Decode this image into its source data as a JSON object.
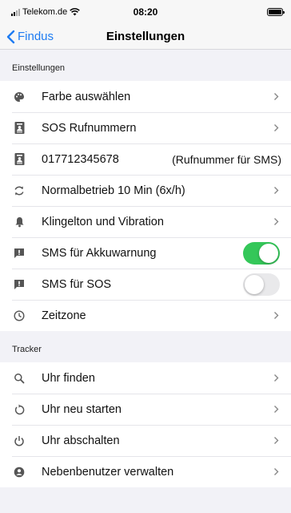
{
  "status": {
    "carrier": "Telekom.de",
    "time": "08:20"
  },
  "nav": {
    "back_label": "Findus",
    "title": "Einstellungen"
  },
  "sections": {
    "settings_header": "Einstellungen",
    "tracker_header": "Tracker"
  },
  "settings": {
    "color": "Farbe auswählen",
    "sos_numbers": "SOS Rufnummern",
    "phone_number": "017712345678",
    "phone_hint": "(Rufnummer für SMS)",
    "mode": "Normalbetrieb 10 Min (6x/h)",
    "ringtone": "Klingelton und Vibration",
    "sms_battery": "SMS für Akkuwarnung",
    "sms_sos": "SMS für SOS",
    "timezone": "Zeitzone"
  },
  "toggles": {
    "sms_battery": true,
    "sms_sos": false
  },
  "tracker": {
    "find": "Uhr finden",
    "restart": "Uhr neu starten",
    "shutdown": "Uhr abschalten",
    "users": "Nebenbenutzer verwalten"
  },
  "colors": {
    "accent": "#1e7cf2",
    "toggle_on": "#34c759",
    "icon": "#555555"
  }
}
